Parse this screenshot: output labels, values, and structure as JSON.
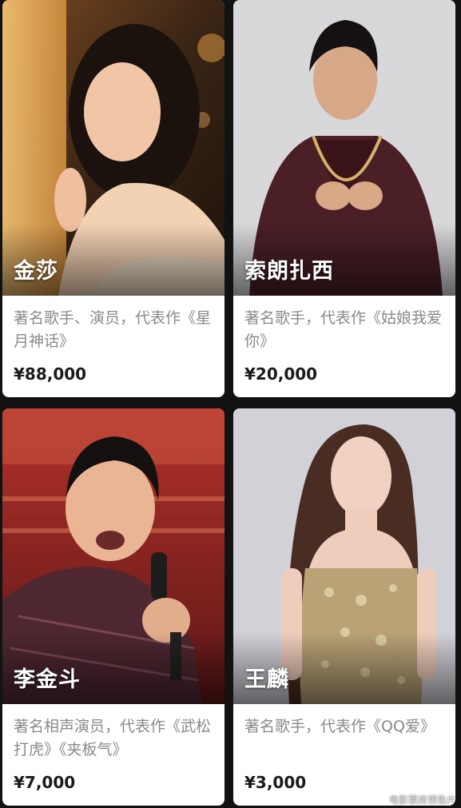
{
  "cards": [
    {
      "name": "金莎",
      "description": "著名歌手、演员，代表作《星月神话》",
      "price": "¥88,000",
      "photo_icon": "portrait-photo"
    },
    {
      "name": "索朗扎西",
      "description": "著名歌手，代表作《姑娘我爱你》",
      "price": "¥20,000",
      "photo_icon": "portrait-photo"
    },
    {
      "name": "李金斗",
      "description": "著名相声演员，代表作《武松打虎》《夹板气》",
      "price": "¥7,000",
      "photo_icon": "portrait-photo"
    },
    {
      "name": "王麟",
      "description": "著名歌手，代表作《QQ爱》",
      "price": "¥3,000",
      "photo_icon": "portrait-photo"
    }
  ],
  "watermark": "电影票房预告片",
  "colors": {
    "page_background": "#121212",
    "card_background": "#ffffff",
    "description_text": "#8a8a8a",
    "price_text": "#1a1a1a"
  }
}
